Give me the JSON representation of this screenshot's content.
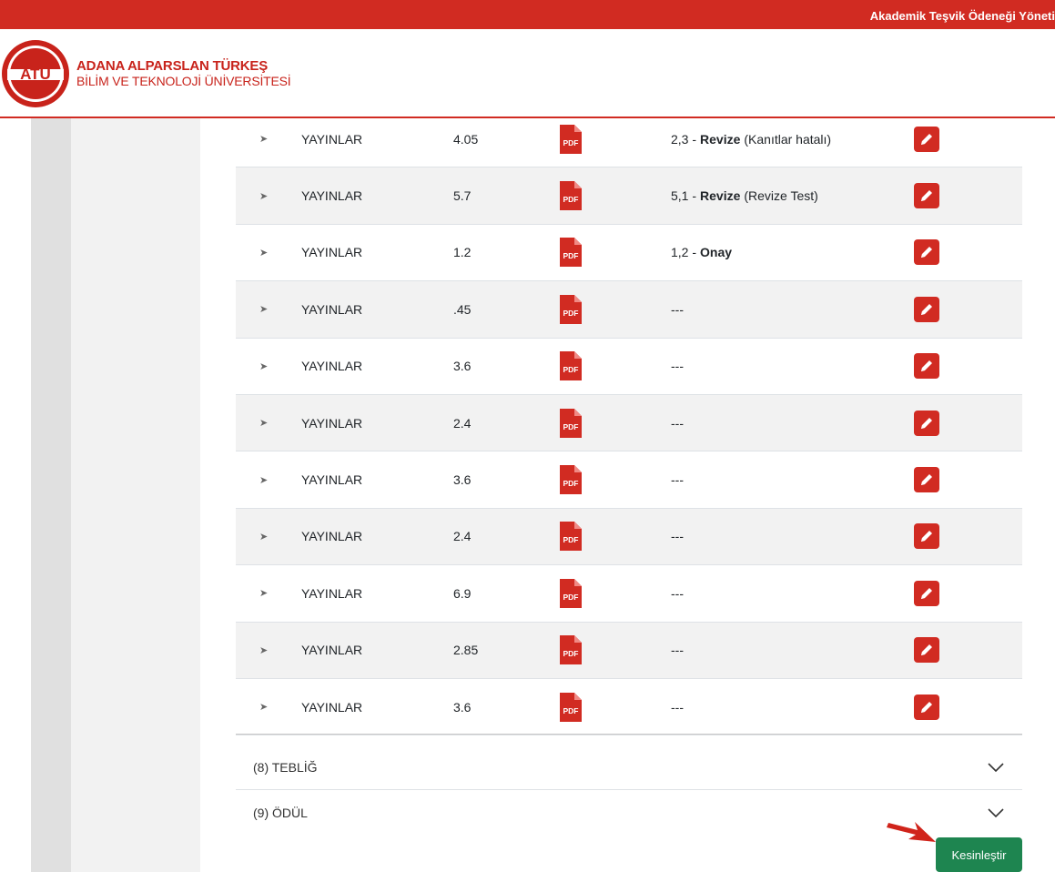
{
  "topbar": {
    "title": "Akademik Teşvik Ödeneği Yöneti"
  },
  "header": {
    "logo_text": "ATÜ",
    "line1": "ADANA ALPARSLAN TÜRKEŞ",
    "line2": "BİLİM VE TEKNOLOJİ ÜNİVERSİTESİ"
  },
  "rows": [
    {
      "category": "YAYINLAR",
      "score": "4.05",
      "pdf": "PDF",
      "status_value": "2,3 -",
      "status_label": "Revize",
      "status_note": "(Kanıtlar hatalı)"
    },
    {
      "category": "YAYINLAR",
      "score": "5.7",
      "pdf": "PDF",
      "status_value": "5,1 -",
      "status_label": "Revize",
      "status_note": "(Revize Test)"
    },
    {
      "category": "YAYINLAR",
      "score": "1.2",
      "pdf": "PDF",
      "status_value": "1,2 -",
      "status_label": "Onay",
      "status_note": ""
    },
    {
      "category": "YAYINLAR",
      "score": ".45",
      "pdf": "PDF",
      "status_value": "---",
      "status_label": "",
      "status_note": ""
    },
    {
      "category": "YAYINLAR",
      "score": "3.6",
      "pdf": "PDF",
      "status_value": "---",
      "status_label": "",
      "status_note": ""
    },
    {
      "category": "YAYINLAR",
      "score": "2.4",
      "pdf": "PDF",
      "status_value": "---",
      "status_label": "",
      "status_note": ""
    },
    {
      "category": "YAYINLAR",
      "score": "3.6",
      "pdf": "PDF",
      "status_value": "---",
      "status_label": "",
      "status_note": ""
    },
    {
      "category": "YAYINLAR",
      "score": "2.4",
      "pdf": "PDF",
      "status_value": "---",
      "status_label": "",
      "status_note": ""
    },
    {
      "category": "YAYINLAR",
      "score": "6.9",
      "pdf": "PDF",
      "status_value": "---",
      "status_label": "",
      "status_note": ""
    },
    {
      "category": "YAYINLAR",
      "score": "2.85",
      "pdf": "PDF",
      "status_value": "---",
      "status_label": "",
      "status_note": ""
    },
    {
      "category": "YAYINLAR",
      "score": "3.6",
      "pdf": "PDF",
      "status_value": "---",
      "status_label": "",
      "status_note": ""
    }
  ],
  "sections": [
    {
      "label": "(8) TEBLİĞ"
    },
    {
      "label": "(9) ÖDÜL"
    }
  ],
  "actions": {
    "finalize_label": "Kesinleştir"
  },
  "colors": {
    "brand_red": "#d12b22",
    "finalize_green": "#1e8550",
    "arrow_red": "#d0241b"
  }
}
